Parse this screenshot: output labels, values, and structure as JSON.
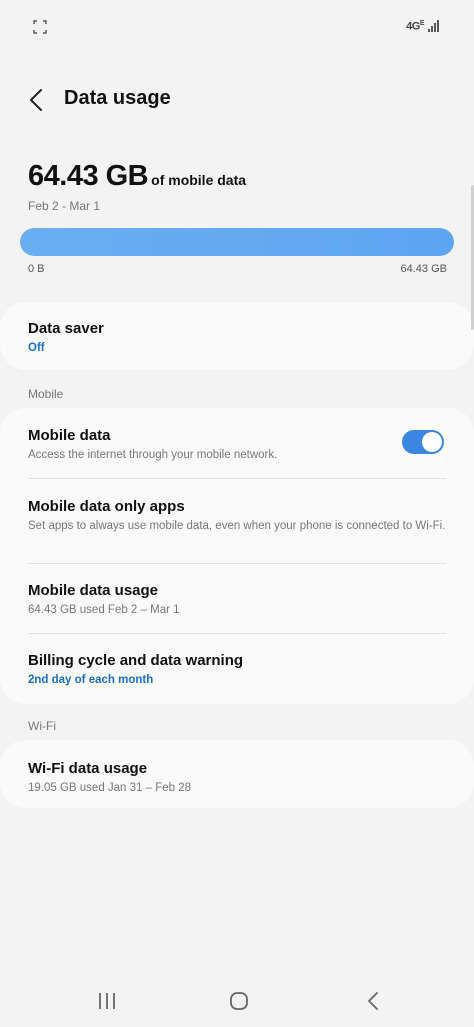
{
  "status": {
    "network": "4G",
    "network_sup": "E"
  },
  "header": {
    "title": "Data usage"
  },
  "summary": {
    "amount": "64.43 GB",
    "suffix": "of mobile data",
    "date_range": "Feb 2 - Mar 1",
    "bar_min": "0 B",
    "bar_max": "64.43 GB",
    "bar_fill_fraction": 1.0
  },
  "data_saver": {
    "title": "Data saver",
    "state": "Off"
  },
  "sections": {
    "mobile": "Mobile",
    "wifi": "Wi-Fi"
  },
  "mobile": {
    "mobile_data": {
      "title": "Mobile data",
      "subtitle": "Access the internet through your mobile network.",
      "enabled": true
    },
    "only_apps": {
      "title": "Mobile data only apps",
      "subtitle": "Set apps to always use mobile data, even when your phone is connected to Wi-Fi."
    },
    "usage": {
      "title": "Mobile data usage",
      "subtitle": "64.43 GB used Feb 2 – Mar 1"
    },
    "billing": {
      "title": "Billing cycle and data warning",
      "subtitle": "2nd day of each month"
    }
  },
  "wifi": {
    "usage": {
      "title": "Wi-Fi data usage",
      "subtitle": "19.05 GB used Jan 31 – Feb 28"
    }
  },
  "colors": {
    "accent": "#3a86e0",
    "bar": "#5ea5f2",
    "link_blue": "#1a6fc4"
  }
}
